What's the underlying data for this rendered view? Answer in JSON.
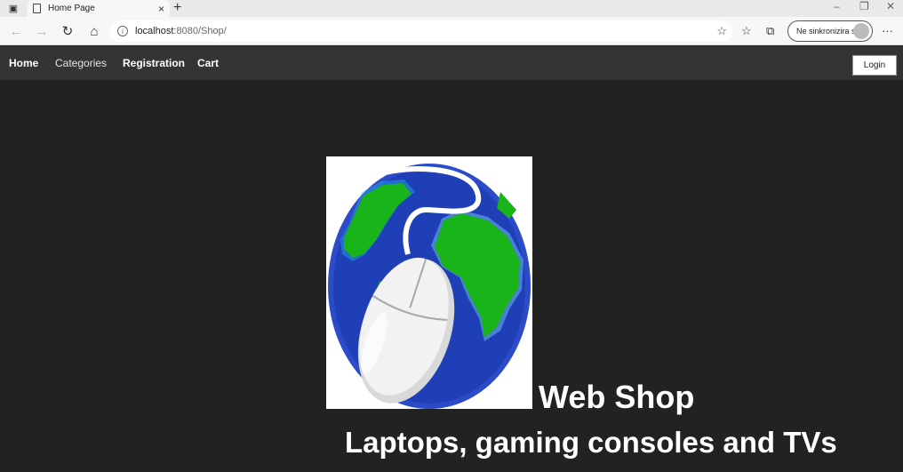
{
  "browser": {
    "tab_title": "Home Page",
    "url_host": "localhost",
    "url_path": ":8080/Shop/",
    "sync_label": "Ne sinkronizira se"
  },
  "nav": {
    "items": [
      {
        "label": "Home"
      },
      {
        "label": "Categories"
      },
      {
        "label": "Registration"
      },
      {
        "label": "Cart"
      }
    ],
    "login_label": "Login"
  },
  "hero": {
    "title": "Web Shop",
    "tagline": "Laptops, gaming consoles and TVs"
  },
  "icons": {
    "logo": "globe-with-computer-mouse"
  },
  "colors": {
    "page_bg": "#222222",
    "nav_bg": "#343434",
    "ocean": "#1f3fb7",
    "land": "#19b31a"
  }
}
